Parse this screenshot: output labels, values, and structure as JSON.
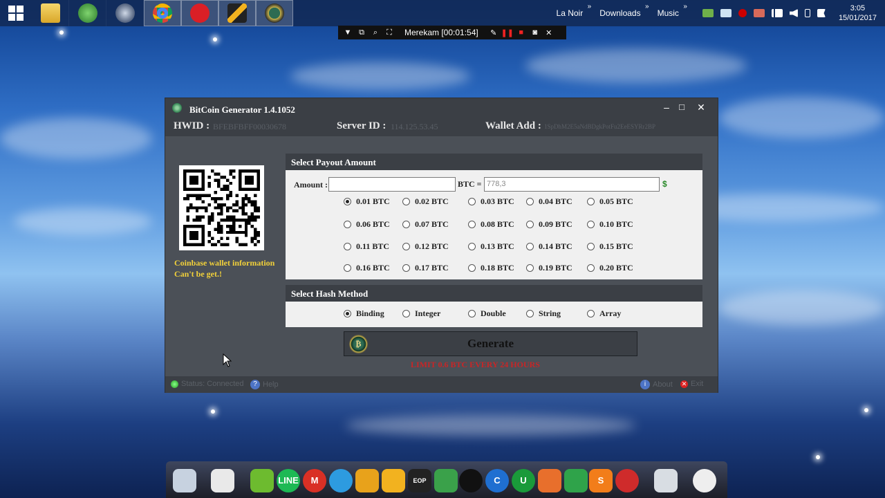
{
  "taskbar": {
    "links": [
      "La Noir",
      "Downloads",
      "Music"
    ],
    "chevron": "»",
    "clock_time": "3:05",
    "clock_date": "15/01/2017",
    "icons": [
      "windows-start-icon",
      "file-explorer-icon",
      "globe-icon",
      "browser-icon",
      "chrome-icon",
      "creative-cloud-icon",
      "bolt-app-icon",
      "bitcoin-app-icon"
    ]
  },
  "recorder": {
    "label": "Merekam [00:01:54]"
  },
  "window": {
    "title": "BitCoin Generator 1.4.1052",
    "controls": {
      "minimize": "–",
      "maximize": "□",
      "close": "✕"
    },
    "hwid_label": "HWID :",
    "hwid_value": "BFEBFBFF00030678",
    "server_label": "Server ID :",
    "server_value": "114.125.53.45",
    "wallet_label": "Wallet Add :",
    "wallet_value": "1SpDhM2E5aNdBDgkPotFu2EeESYRr2BP",
    "wallet_msg_line1": "Coinbase wallet information",
    "wallet_msg_line2": "Can't be get.!",
    "payout": {
      "header": "Select Payout Amount",
      "amount_label": "Amount :",
      "amount_value": "",
      "btc_eq": "BTC  =",
      "usd_value": "778,3",
      "dollar": "$",
      "options": [
        "0.01 BTC",
        "0.02 BTC",
        "0.03 BTC",
        "0.04 BTC",
        "0.05 BTC",
        "0.06 BTC",
        "0.07 BTC",
        "0.08 BTC",
        "0.09 BTC",
        "0.10 BTC",
        "0.11 BTC",
        "0.12 BTC",
        "0.13 BTC",
        "0.14 BTC",
        "0.15 BTC",
        "0.16 BTC",
        "0.17 BTC",
        "0.18 BTC",
        "0.19 BTC",
        "0.20 BTC"
      ],
      "selected": "0.01 BTC"
    },
    "hash": {
      "header": "Select Hash Method",
      "options": [
        "Binding",
        "Integer",
        "Double",
        "String",
        "Array"
      ],
      "selected": "Binding"
    },
    "generate_label": "Generate",
    "generate_icon_glyph": "₿",
    "limit_text": "LIMIT 0.6 BTC EVERY 24 HOURS",
    "status": {
      "connection": "Status: Connected",
      "help": "Help",
      "about": "About",
      "exit": "Exit"
    },
    "colors": {
      "accent_yellow": "#f2d13a",
      "limit_red": "#e01e1e",
      "panel_dark": "#3b3f45"
    }
  },
  "dock": {
    "icons": [
      "computer-icon",
      "document-icon",
      "flower-icon",
      "line-icon",
      "gmail-icon",
      "sync-icon",
      "music-icon",
      "vlc-icon",
      "piano-icon",
      "maps-icon",
      "record-icon",
      "ccleaner-icon",
      "uc-icon",
      "beach-icon",
      "arrows-icon",
      "sublime-icon",
      "flash-icon",
      "trash-icon",
      "clock-icon"
    ],
    "labels": {
      "line": "LINE",
      "gmail": "M",
      "ccleaner": "C",
      "uc": "U",
      "sublime": "S",
      "piano": "EOP"
    }
  }
}
